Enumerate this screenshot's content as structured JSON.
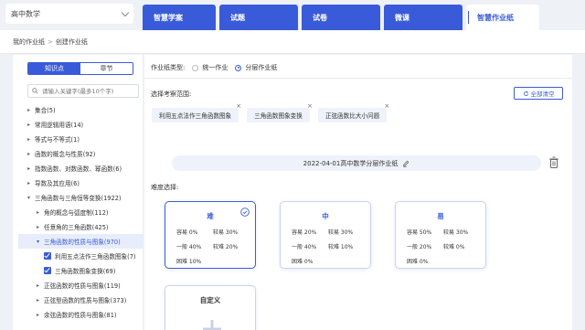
{
  "subject": {
    "label": "高中数学"
  },
  "tabs": [
    {
      "label": "智慧学案"
    },
    {
      "label": "试题"
    },
    {
      "label": "试卷"
    },
    {
      "label": "微课"
    },
    {
      "label": "智慧作业纸"
    }
  ],
  "breadcrumb": {
    "root": "我的作业纸",
    "sep": ">",
    "current": "创建作业纸"
  },
  "sidebar": {
    "seg": [
      "知识点",
      "章节"
    ],
    "search_placeholder": "请输入关键字(最多10个字)",
    "tree": [
      {
        "caret": "▸",
        "label": "集合(5)"
      },
      {
        "caret": "▸",
        "label": "常用逻辑用语(14)"
      },
      {
        "caret": "▸",
        "label": "等式与不等式(1)"
      },
      {
        "caret": "▸",
        "label": "函数的概念与性质(92)"
      },
      {
        "caret": "▸",
        "label": "指数函数、对数函数、幂函数(6)"
      },
      {
        "caret": "▸",
        "label": "导数及其应用(6)"
      },
      {
        "caret": "▾",
        "label": "三角函数与三角恒等变换(1922)"
      },
      {
        "caret": "▸",
        "label": "角的概念与弧度制(112)"
      },
      {
        "caret": "▸",
        "label": "任意角的三角函数(425)"
      },
      {
        "caret": "▾",
        "label": "三角函数的性质与图象(970)"
      },
      {
        "label": "利用五点法作三角函数图象(7)"
      },
      {
        "label": "三角函数图象变换(69)"
      },
      {
        "caret": "▸",
        "label": "正弦函数的性质与图象(119)"
      },
      {
        "caret": "▸",
        "label": "正弦型函数的性质与图象(373)"
      },
      {
        "caret": "▸",
        "label": "余弦函数的性质与图象(81)"
      }
    ]
  },
  "main": {
    "type_label": "作业纸类型:",
    "type_options": [
      "统一作业",
      "分层作业纸"
    ],
    "range_label": "选择考察范围:",
    "clear_label": "全部清空",
    "chips": [
      "利用五点法作三角函数图象",
      "三角函数图象变换",
      "正弦函数比大小问题"
    ],
    "chip_close": "×",
    "title": "2022-04-01高中数学分层作业纸",
    "difficulty_label": "难度选择:",
    "cards": [
      {
        "title": "难",
        "cells": [
          "容易 0%",
          "较易 30%",
          "一般 40%",
          "较难 20%",
          "困难 10%"
        ]
      },
      {
        "title": "中",
        "cells": [
          "容易 20%",
          "较易 30%",
          "一般 40%",
          "较难 10%",
          "困难 0%"
        ]
      },
      {
        "title": "易",
        "cells": [
          "容易 50%",
          "较易 30%",
          "一般 20%",
          "较难 0%",
          "困难 0%"
        ]
      },
      {
        "title": "自定义"
      }
    ]
  },
  "colors": {
    "accent": "#3a5bd9",
    "chip_bg": "#eef2fb",
    "page_bg": "#eef1f6"
  }
}
